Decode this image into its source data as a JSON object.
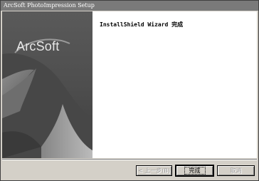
{
  "window": {
    "title": "ArcSoft PhotoImpression Setup"
  },
  "banner": {
    "logo_text": "ArcSoft"
  },
  "main": {
    "heading": "InstallShield Wizard 完成"
  },
  "buttons": {
    "back_label": "< 上一步(B)",
    "finish_label": "完成",
    "cancel_label": "取消"
  }
}
